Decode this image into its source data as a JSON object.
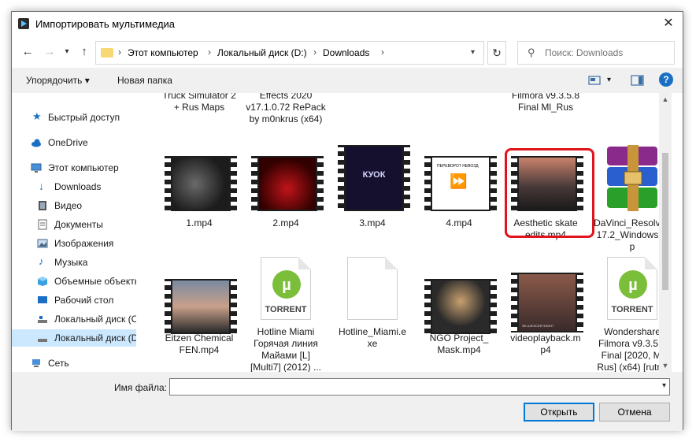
{
  "window": {
    "title": "Импортировать мультимедиа",
    "close_label": "✕"
  },
  "address": {
    "crumbs": [
      "Этот компьютер",
      "Локальный диск (D:)",
      "Downloads"
    ],
    "separator": "›"
  },
  "search": {
    "placeholder": "Поиск: Downloads"
  },
  "toolbar": {
    "organize_label": "Упорядочить ▾",
    "new_folder_label": "Новая папка",
    "help_label": "?"
  },
  "sidebar": {
    "items": [
      {
        "label": "Быстрый доступ",
        "icon": "star-icon"
      },
      {
        "label": "OneDrive",
        "icon": "cloud-icon"
      },
      {
        "label": "Этот компьютер",
        "icon": "computer-icon"
      },
      {
        "label": "Downloads",
        "icon": "download-arrow-icon"
      },
      {
        "label": "Видео",
        "icon": "video-icon"
      },
      {
        "label": "Документы",
        "icon": "documents-icon"
      },
      {
        "label": "Изображения",
        "icon": "pictures-icon"
      },
      {
        "label": "Музыка",
        "icon": "music-icon"
      },
      {
        "label": "Объемные объекты",
        "icon": "3d-objects-icon"
      },
      {
        "label": "Рабочий стол",
        "icon": "desktop-icon"
      },
      {
        "label": "Локальный диск (C",
        "icon": "drive-icon"
      },
      {
        "label": "Локальный диск (D",
        "icon": "drive-icon"
      },
      {
        "label": "Сеть",
        "icon": "network-icon"
      }
    ]
  },
  "files": {
    "row0": [
      {
        "name": "Truck Simulator 2\n+ Rus Maps"
      },
      {
        "name": "Effects 2020\nv17.1.0.72 RePack\nby m0nkrus (x64)"
      },
      {
        "name": "Filmora v9.3.5.8\nFinal Ml_Rus"
      }
    ],
    "row1": [
      {
        "name": "1.mp4"
      },
      {
        "name": "2.mp4"
      },
      {
        "name": "3.mp4"
      },
      {
        "name": "4.mp4"
      },
      {
        "name": "Aesthetic skate\nedits.mp4"
      },
      {
        "name": "DaVinci_Resolve_\n17.2_Windows.zi\np"
      }
    ],
    "row2": [
      {
        "name": "Eitzen Chemical\nFEN.mp4"
      },
      {
        "name": "Hotline Miami\nГорячая линия\nМайами [L]\n[Multi7] (2012) ..."
      },
      {
        "name": "Hotline_Miami.e\nxe"
      },
      {
        "name": "NGO Project_\nMask.mp4"
      },
      {
        "name": "videoplayback.m\np4"
      },
      {
        "name": "Wondershare\nFilmora v9.3.5.8\nFinal [2020, Ml\nRus] (x64) [rutr..."
      }
    ],
    "torrent_label": "TORRENT",
    "thumb_texts": {
      "t3": "КУОК",
      "t4": "ПЕРЕВОРОТ НЕВОЗД",
      "t11": "ФБ  АЛЕКСЕЙ ФЛИНТ"
    }
  },
  "footer": {
    "filename_label": "Имя файла:",
    "filename_value": "",
    "open_label": "Открыть",
    "cancel_label": "Отмена"
  },
  "colors": {
    "highlight": "#e0141a",
    "selection": "#cce8ff",
    "accent": "#0078d7"
  }
}
